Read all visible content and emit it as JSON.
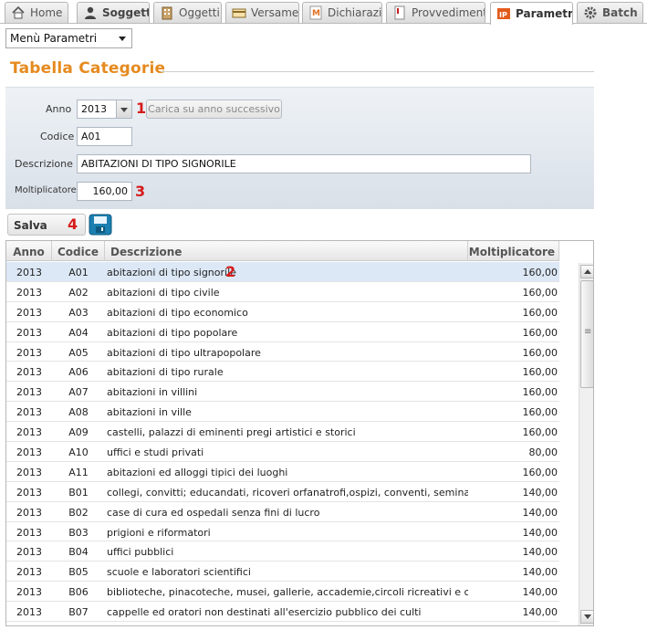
{
  "tabs": [
    {
      "label": "Home",
      "icon": "home-icon"
    },
    {
      "label": "Soggetti",
      "icon": "user-icon"
    },
    {
      "label": "Oggetti",
      "icon": "building-icon"
    },
    {
      "label": "Versamenti",
      "icon": "payment-icon"
    },
    {
      "label": "Dichiarazioni",
      "icon": "declaration-icon"
    },
    {
      "label": "Provvedimenti",
      "icon": "document-icon"
    },
    {
      "label": "Parametri",
      "icon": "parameters-icon",
      "active": true
    },
    {
      "label": "Batch",
      "icon": "gear-icon"
    }
  ],
  "menu_select": {
    "value": "Menù Parametri"
  },
  "section_title": "Tabella Categorie",
  "form": {
    "anno_label": "Anno",
    "anno_value": "2013",
    "load_button": "Carica su anno successivo",
    "codice_label": "Codice",
    "codice_value": "A01",
    "descrizione_label": "Descrizione",
    "descrizione_value": "ABITAZIONI DI TIPO SIGNORILE",
    "moltiplicatore_label": "Moltiplicatore",
    "moltiplicatore_value": "160,00"
  },
  "save_button": "Salva",
  "markers": {
    "m1": "1",
    "m2": "2",
    "m3": "3",
    "m4": "4"
  },
  "grid": {
    "headers": {
      "anno": "Anno",
      "codice": "Codice",
      "descrizione": "Descrizione",
      "moltiplicatore": "Moltiplicatore"
    },
    "rows": [
      {
        "anno": "2013",
        "codice": "A01",
        "descrizione": "abitazioni di tipo signorile",
        "moltiplicatore": "160,00"
      },
      {
        "anno": "2013",
        "codice": "A02",
        "descrizione": "abitazioni di tipo civile",
        "moltiplicatore": "160,00"
      },
      {
        "anno": "2013",
        "codice": "A03",
        "descrizione": "abitazioni di tipo economico",
        "moltiplicatore": "160,00"
      },
      {
        "anno": "2013",
        "codice": "A04",
        "descrizione": "abitazioni di tipo popolare",
        "moltiplicatore": "160,00"
      },
      {
        "anno": "2013",
        "codice": "A05",
        "descrizione": "abitazioni di tipo ultrapopolare",
        "moltiplicatore": "160,00"
      },
      {
        "anno": "2013",
        "codice": "A06",
        "descrizione": "abitazioni di tipo rurale",
        "moltiplicatore": "160,00"
      },
      {
        "anno": "2013",
        "codice": "A07",
        "descrizione": "abitazioni in villini",
        "moltiplicatore": "160,00"
      },
      {
        "anno": "2013",
        "codice": "A08",
        "descrizione": "abitazioni in ville",
        "moltiplicatore": "160,00"
      },
      {
        "anno": "2013",
        "codice": "A09",
        "descrizione": "castelli, palazzi di eminenti pregi artistici e storici",
        "moltiplicatore": "160,00"
      },
      {
        "anno": "2013",
        "codice": "A10",
        "descrizione": "uffici e studi privati",
        "moltiplicatore": "80,00"
      },
      {
        "anno": "2013",
        "codice": "A11",
        "descrizione": "abitazioni ed alloggi tipici dei luoghi",
        "moltiplicatore": "160,00"
      },
      {
        "anno": "2013",
        "codice": "B01",
        "descrizione": "collegi, convitti; educandati, ricoveri orfanatrofi,ospizi, conventi, seminari, caserme",
        "moltiplicatore": "140,00"
      },
      {
        "anno": "2013",
        "codice": "B02",
        "descrizione": "case di cura ed ospedali senza fini di lucro",
        "moltiplicatore": "140,00"
      },
      {
        "anno": "2013",
        "codice": "B03",
        "descrizione": "prigioni e riformatori",
        "moltiplicatore": "140,00"
      },
      {
        "anno": "2013",
        "codice": "B04",
        "descrizione": "uffici pubblici",
        "moltiplicatore": "140,00"
      },
      {
        "anno": "2013",
        "codice": "B05",
        "descrizione": "scuole e laboratori scientifici",
        "moltiplicatore": "140,00"
      },
      {
        "anno": "2013",
        "codice": "B06",
        "descrizione": "biblioteche, pinacoteche, musei, gallerie, accademie,circoli ricreativi e culturali senza",
        "moltiplicatore": "140,00"
      },
      {
        "anno": "2013",
        "codice": "B07",
        "descrizione": "cappelle ed oratori non destinati all'esercizio pubblico dei culti",
        "moltiplicatore": "140,00"
      }
    ],
    "selected_index": 0
  },
  "colors": {
    "title": "#e58a1f",
    "marker": "#d61b1b",
    "selected_row": "#dce8f6"
  }
}
